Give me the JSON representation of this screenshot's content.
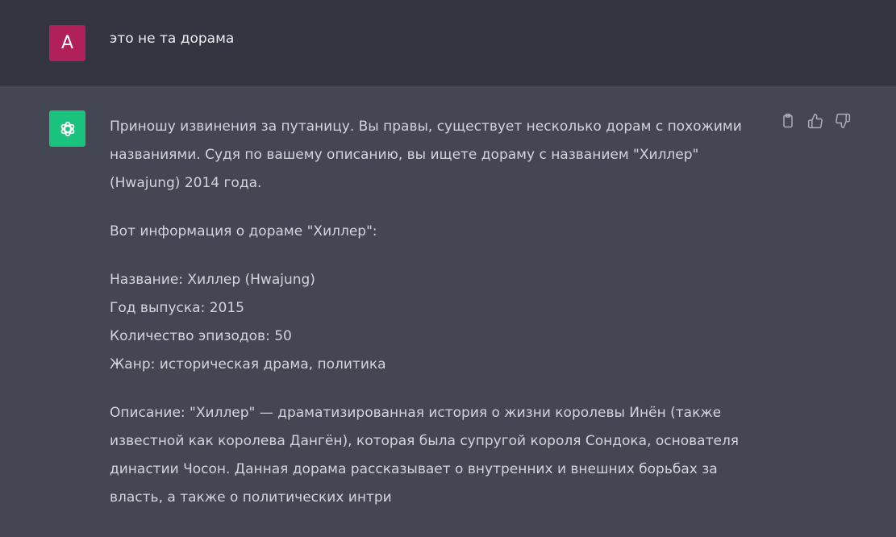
{
  "user_message": {
    "avatar_letter": "A",
    "text": "это не та дорама"
  },
  "assistant_message": {
    "paragraph1_lines": [
      "Приношу извинения за путаницу. Вы правы, существует несколько дорам с похожими",
      "названиями. Судя по вашему описанию, вы ищете дораму с названием \"Хиллер\"",
      "(Hwajung) 2014 года."
    ],
    "paragraph2": "Вот информация о дораме \"Хиллер\":",
    "info_lines": [
      "Название: Хиллер (Hwajung)",
      "Год выпуска: 2015",
      "Количество эпизодов: 50",
      "Жанр: историческая драма, политика"
    ],
    "description_lines": [
      "Описание: \"Хиллер\" — драматизированная история о жизни королевы Инён (также",
      "известной как королева Дангён), которая была супругой короля Сондока, основателя",
      "династии Чосон. Данная дорама рассказывает о внутренних и внешних борьбах за",
      "власть, а также о политических интри"
    ]
  },
  "actions": {
    "icons": [
      "clipboard-icon",
      "thumbs-up-icon",
      "thumbs-down-icon"
    ]
  },
  "colors": {
    "user_bg": "#343541",
    "assistant_bg": "#444654",
    "user_avatar": "#b0215a",
    "assistant_avatar": "#19c37d"
  }
}
